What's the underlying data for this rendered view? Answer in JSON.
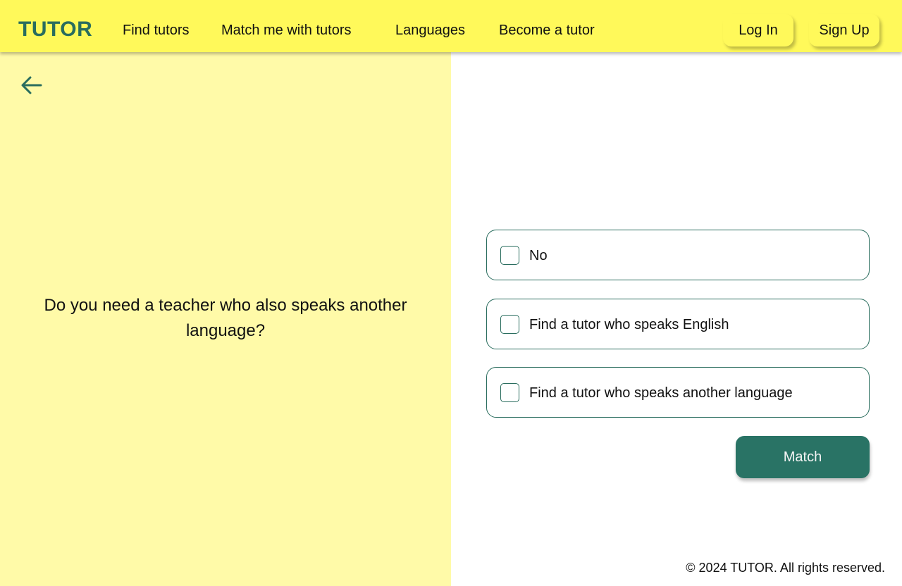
{
  "header": {
    "logo": "TUTOR",
    "nav": {
      "find_tutors": "Find tutors",
      "match_me": "Match me with tutors",
      "languages": "Languages",
      "become_tutor": "Become a tutor"
    },
    "login_label": "Log In",
    "signup_label": "Sign Up"
  },
  "left": {
    "back_icon": "arrow-left-icon",
    "question": "Do you need a teacher who also speaks another language?"
  },
  "options": [
    {
      "label": "No",
      "checked": false
    },
    {
      "label": "Find a tutor who speaks English",
      "checked": false
    },
    {
      "label": "Find a tutor who speaks another language",
      "checked": false
    }
  ],
  "match_label": "Match",
  "footer": {
    "copyright": "© 2024 TUTOR. All rights reserved."
  },
  "colors": {
    "header_bg": "#fff95a",
    "left_panel_bg": "#fffaa8",
    "brand_green": "#297365"
  }
}
